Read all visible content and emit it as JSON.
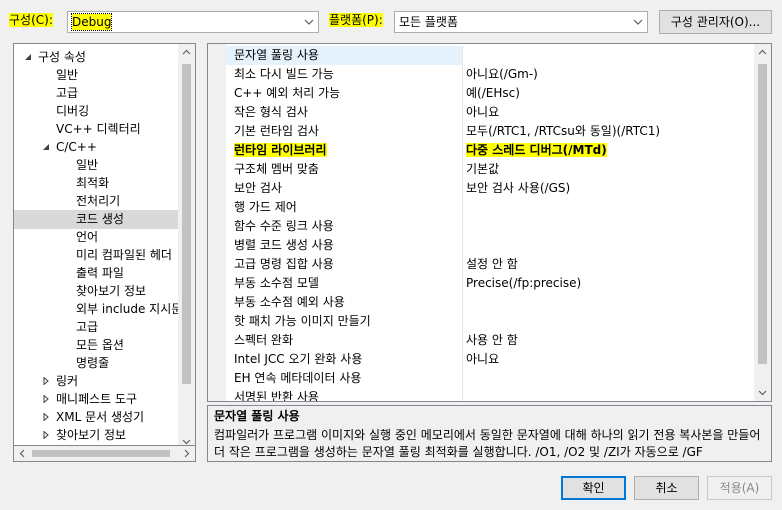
{
  "config": {
    "label": "구성(C):",
    "value": "Debug",
    "platform_label": "플랫폼(P):",
    "platform_value": "모든 플랫폼",
    "manager_button": "구성 관리자(O)..."
  },
  "tree": [
    {
      "label": "구성 속성",
      "level": 0,
      "expanded": true
    },
    {
      "label": "일반",
      "level": 1
    },
    {
      "label": "고급",
      "level": 1
    },
    {
      "label": "디버깅",
      "level": 1
    },
    {
      "label": "VC++ 디렉터리",
      "level": 1
    },
    {
      "label": "C/C++",
      "level": 1,
      "expanded": true
    },
    {
      "label": "일반",
      "level": 2
    },
    {
      "label": "최적화",
      "level": 2
    },
    {
      "label": "전처리기",
      "level": 2
    },
    {
      "label": "코드 생성",
      "level": 2,
      "selected": true
    },
    {
      "label": "언어",
      "level": 2
    },
    {
      "label": "미리 컴파일된 헤더",
      "level": 2
    },
    {
      "label": "출력 파일",
      "level": 2
    },
    {
      "label": "찾아보기 정보",
      "level": 2
    },
    {
      "label": "외부 include 지시문",
      "level": 2
    },
    {
      "label": "고급",
      "level": 2
    },
    {
      "label": "모든 옵션",
      "level": 2
    },
    {
      "label": "명령줄",
      "level": 2
    },
    {
      "label": "링커",
      "level": 1,
      "collapsed": true
    },
    {
      "label": "매니페스트 도구",
      "level": 1,
      "collapsed": true
    },
    {
      "label": "XML 문서 생성기",
      "level": 1,
      "collapsed": true
    },
    {
      "label": "찾아보기 정보",
      "level": 1,
      "collapsed": true
    }
  ],
  "properties": [
    {
      "name": "문자열 풀링 사용",
      "value": ""
    },
    {
      "name": "최소 다시 빌드 가능",
      "value": "아니요(/Gm-)"
    },
    {
      "name": "C++ 예외 처리 가능",
      "value": "예(/EHsc)"
    },
    {
      "name": "작은 형식 검사",
      "value": "아니요"
    },
    {
      "name": "기본 런타임 검사",
      "value": "모두(/RTC1, /RTCsu와 동일)(/RTC1)"
    },
    {
      "name": "런타임 라이브러리",
      "value": "다중 스레드 디버그(/MTd)",
      "bold": true,
      "highlight": true
    },
    {
      "name": "구조체 멤버 맞춤",
      "value": "기본값"
    },
    {
      "name": "보안 검사",
      "value": "보안 검사 사용(/GS)"
    },
    {
      "name": "행 가드 제어",
      "value": ""
    },
    {
      "name": "함수 수준 링크 사용",
      "value": ""
    },
    {
      "name": "병렬 코드 생성 사용",
      "value": ""
    },
    {
      "name": "고급 명령 집합 사용",
      "value": "설정 안 함"
    },
    {
      "name": "부동 소수점 모델",
      "value": "Precise(/fp:precise)"
    },
    {
      "name": "부동 소수점 예외 사용",
      "value": ""
    },
    {
      "name": "핫 패치 가능 이미지 만들기",
      "value": ""
    },
    {
      "name": "스펙터 완화",
      "value": "사용 안 함"
    },
    {
      "name": "Intel JCC 오기 완화 사용",
      "value": "아니요"
    },
    {
      "name": "EH 연속 메타데이터 사용",
      "value": ""
    },
    {
      "name": "서명된 반환 사용",
      "value": ""
    }
  ],
  "description": {
    "title": "문자열 풀링 사용",
    "body": "컴파일러가 프로그램 이미지와 실행 중인 메모리에서 동일한 문자열에 대해 하나의 읽기 전용 복사본을 만들어 더 작은 프로그램을 생성하는 문자열 풀링 최적화를 실행합니다. /O1, /O2 및 /ZI가 자동으로 /GF"
  },
  "buttons": {
    "ok": "확인",
    "cancel": "취소",
    "apply": "적용(A)"
  },
  "colors": {
    "highlight": "#ffff00",
    "selection": "#d9d9d9",
    "accent": "#0078d7"
  }
}
